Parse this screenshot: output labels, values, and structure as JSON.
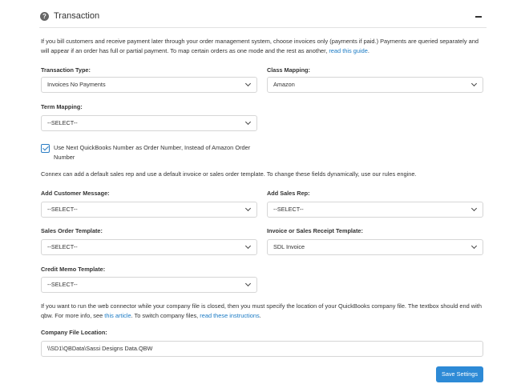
{
  "section": {
    "title": "Transaction"
  },
  "intro": {
    "text": "If you bill customers and receive payment later through your order management system, choose invoices only (payments if paid.) Payments are queried separately and will appear if an order has full or partial payment. To map certain orders as one mode and the rest as another, ",
    "link": "read this guide",
    "after": "."
  },
  "fields": {
    "transaction_type": {
      "label": "Transaction Type:",
      "value": "Invoices No Payments"
    },
    "class_mapping": {
      "label": "Class Mapping:",
      "value": "Amazon"
    },
    "term_mapping": {
      "label": "Term Mapping:",
      "value": "--SELECT--"
    },
    "add_customer_message": {
      "label": "Add Customer Message:",
      "value": "--SELECT--"
    },
    "add_sales_rep": {
      "label": "Add Sales Rep:",
      "value": "--SELECT--"
    },
    "sales_order_template": {
      "label": "Sales Order Template:",
      "value": "--SELECT--"
    },
    "invoice_template": {
      "label": "Invoice or Sales Receipt Template:",
      "value": "SDL Invoice"
    },
    "credit_memo_template": {
      "label": "Credit Memo Template:",
      "value": "--SELECT--"
    }
  },
  "checkbox": {
    "checked": true,
    "line1": "Use Next QuickBooks Number as Order Number, Instead of Amazon Order",
    "line2": "Number"
  },
  "defaults_text": "Connex can add a default sales rep and use a default invoice or sales order template. To change these fields dynamically, use our rules engine.",
  "company_file_note": {
    "text1": "If you want to run the web connector while your company file is closed, then you must specify the location of your QuickBooks company file. The textbox should end with",
    "text2a": "qbw. For more info, see ",
    "link1": "this article",
    "text2b": ". To switch company files, ",
    "link2": "read these instructions",
    "text2c": "."
  },
  "company_file": {
    "label": "Company File Location:",
    "value": "\\\\SD1\\QBData\\Sassi Designs Data.QBW"
  },
  "save_button": {
    "label": "Save Settings"
  },
  "colors": {
    "accent": "#2d8ad6",
    "link": "#1a7ac4"
  }
}
